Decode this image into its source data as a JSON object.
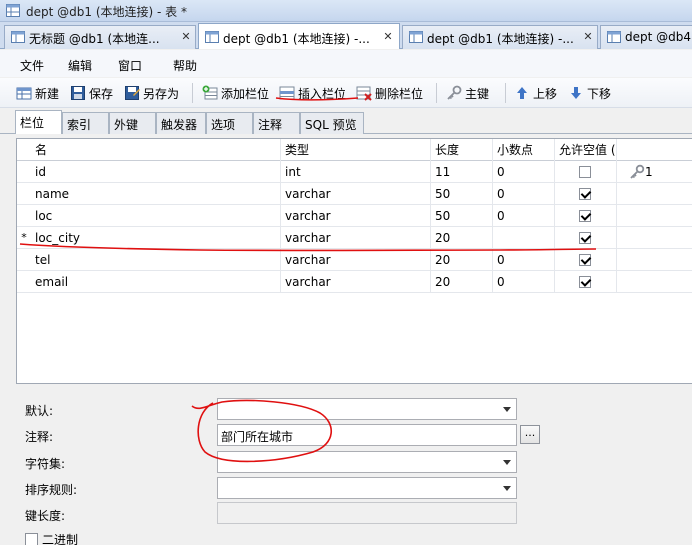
{
  "window": {
    "title": "dept @db1 (本地连接) - 表 *"
  },
  "doc_tabs": [
    {
      "label": "无标题 @db1 (本地连...",
      "close": "✕"
    },
    {
      "label": "dept @db1 (本地连接) -...",
      "close": "✕"
    },
    {
      "label": "dept @db1 (本地连接) -...",
      "close": "✕"
    },
    {
      "label": "dept @db4",
      "close": ""
    }
  ],
  "menu": [
    "文件",
    "编辑",
    "窗口",
    "帮助"
  ],
  "toolbar": {
    "new": "新建",
    "save": "保存",
    "save_as": "另存为",
    "add_field": "添加栏位",
    "insert_field": "插入栏位",
    "delete_field": "删除栏位",
    "primary_key": "主键",
    "move_up": "上移",
    "move_down": "下移"
  },
  "sub_tabs": [
    "栏位",
    "索引",
    "外键",
    "触发器",
    "选项",
    "注释",
    "SQL 预览"
  ],
  "grid": {
    "headers": [
      "名",
      "类型",
      "长度",
      "小数点",
      "允许空值 ("
    ],
    "rows": [
      {
        "marker": "",
        "name": "id",
        "type": "int",
        "length": "11",
        "decimals": "0",
        "nullable": false,
        "key": "1"
      },
      {
        "marker": "",
        "name": "name",
        "type": "varchar",
        "length": "50",
        "decimals": "0",
        "nullable": true,
        "key": ""
      },
      {
        "marker": "",
        "name": "loc",
        "type": "varchar",
        "length": "50",
        "decimals": "0",
        "nullable": true,
        "key": ""
      },
      {
        "marker": "*",
        "name": "loc_city",
        "type": "varchar",
        "length": "20",
        "decimals": "",
        "nullable": true,
        "key": ""
      },
      {
        "marker": "",
        "name": "tel",
        "type": "varchar",
        "length": "20",
        "decimals": "0",
        "nullable": true,
        "key": ""
      },
      {
        "marker": "",
        "name": "email",
        "type": "varchar",
        "length": "20",
        "decimals": "0",
        "nullable": true,
        "key": ""
      }
    ]
  },
  "properties": {
    "default_label": "默认:",
    "default_value": "",
    "comment_label": "注释:",
    "comment_value": "部门所在城市",
    "comment_button": "...",
    "charset_label": "字符集:",
    "charset_value": "",
    "collation_label": "排序规则:",
    "collation_value": "",
    "key_length_label": "键长度:",
    "key_length_value": "",
    "binary_label": "二进制"
  },
  "annotation_color": "#e01010"
}
